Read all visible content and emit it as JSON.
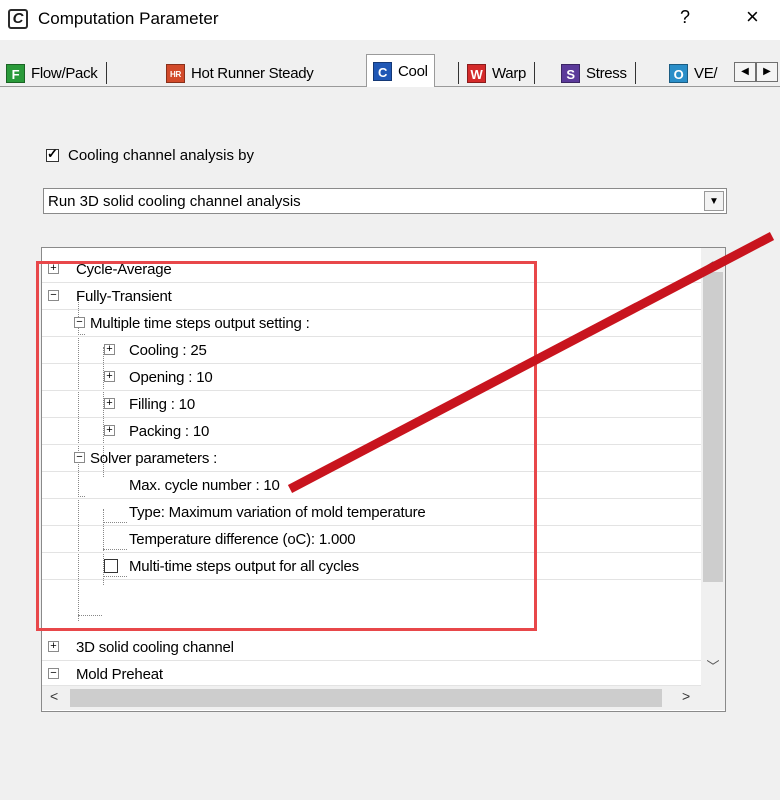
{
  "window": {
    "title": "Computation Parameter",
    "help_label": "?",
    "close_label": "×",
    "app_icon_letter": "C"
  },
  "tabs": [
    {
      "badge": "F",
      "badge_color": "#2a9a3a",
      "label": "Flow/Pack"
    },
    {
      "badge": "HR",
      "badge_color": "#d24a2a",
      "label": "Hot Runner Steady"
    },
    {
      "badge": "C",
      "badge_color": "#1f57b5",
      "label": "Cool",
      "active": true
    },
    {
      "badge": "W",
      "badge_color": "#d42a2a",
      "label": "Warp"
    },
    {
      "badge": "S",
      "badge_color": "#5b3a9a",
      "label": "Stress"
    },
    {
      "badge": "O",
      "badge_color": "#2a8ec8",
      "label": "VE/"
    }
  ],
  "cooling": {
    "checkbox_label": "Cooling channel analysis by",
    "checked": true,
    "method_value": "Run 3D solid cooling channel analysis"
  },
  "tree": {
    "cycle_average": "Cycle-Average",
    "fully_transient": "Fully-Transient",
    "multi_steps": "Multiple time steps output setting :",
    "cooling": "Cooling :  25",
    "opening": "Opening :  10",
    "filling": "Filling :  10",
    "packing": "Packing :  10",
    "solver": "Solver parameters :",
    "max_cycle": "Max. cycle number : 10",
    "type": "Type: Maximum variation of mold temperature",
    "temp_diff": "Temperature difference (oC): 1.000",
    "multi_all": "Multi-time steps output for all cycles",
    "solid_channel": "3D solid cooling channel",
    "mold_preheat": "Mold Preheat"
  },
  "colors": {
    "highlight": "#e8474a",
    "arrow": "#c8141e"
  }
}
